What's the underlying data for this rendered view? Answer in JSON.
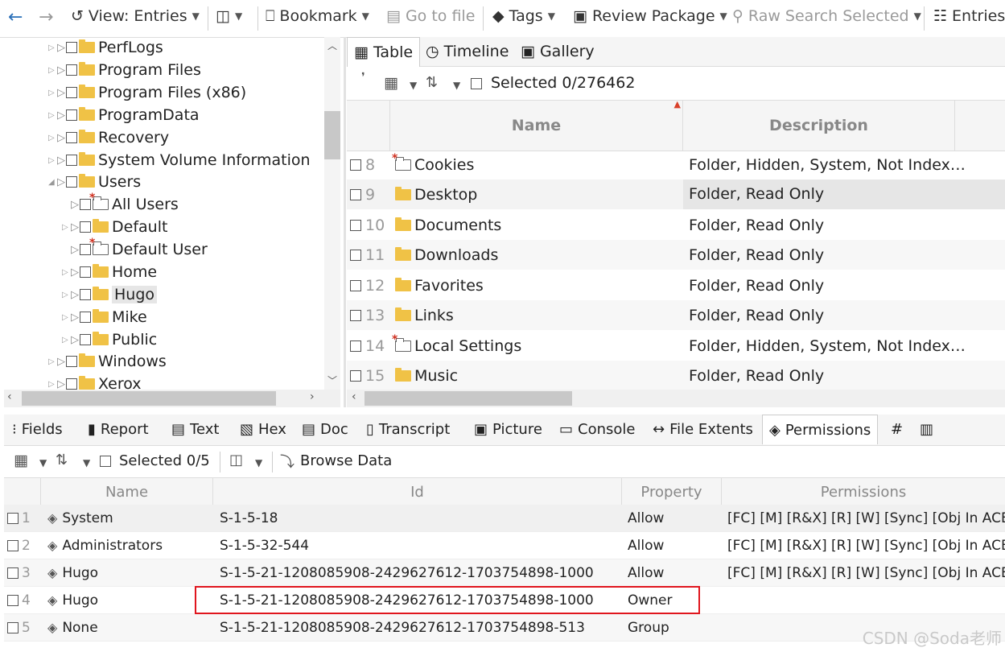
{
  "toolbar": {
    "back": "←",
    "forward": "→",
    "view_label": "View: Entries",
    "bookmark_label": "Bookmark",
    "goto_file_label": "Go to file",
    "tags_label": "Tags",
    "review_package_label": "Review Package",
    "raw_search_label": "Raw Search Selected",
    "entries_label": "Entries"
  },
  "tree": {
    "items": [
      {
        "label": "PerfLogs"
      },
      {
        "label": "Program Files"
      },
      {
        "label": "Program Files (x86)"
      },
      {
        "label": "ProgramData"
      },
      {
        "label": "Recovery"
      },
      {
        "label": "System Volume Information"
      },
      {
        "label": "Users"
      },
      {
        "label": "All Users"
      },
      {
        "label": "Default"
      },
      {
        "label": "Default User"
      },
      {
        "label": "Home"
      },
      {
        "label": "Hugo"
      },
      {
        "label": "Mike"
      },
      {
        "label": "Public"
      },
      {
        "label": "Windows"
      },
      {
        "label": "Xerox"
      }
    ]
  },
  "main_tabs": [
    {
      "label": "Table"
    },
    {
      "label": "Timeline"
    },
    {
      "label": "Gallery"
    }
  ],
  "main_selected": "Selected 0/276462",
  "main_columns": {
    "name": "Name",
    "description": "Description"
  },
  "main_rows": [
    {
      "idx": "8",
      "name": "Cookies",
      "desc": "Folder, Hidden, System, Not Index…"
    },
    {
      "idx": "9",
      "name": "Desktop",
      "desc": "Folder, Read Only"
    },
    {
      "idx": "10",
      "name": "Documents",
      "desc": "Folder, Read Only"
    },
    {
      "idx": "11",
      "name": "Downloads",
      "desc": "Folder, Read Only"
    },
    {
      "idx": "12",
      "name": "Favorites",
      "desc": "Folder, Read Only"
    },
    {
      "idx": "13",
      "name": "Links",
      "desc": "Folder, Read Only"
    },
    {
      "idx": "14",
      "name": "Local Settings",
      "desc": "Folder, Hidden, System, Not Index…"
    },
    {
      "idx": "15",
      "name": "Music",
      "desc": "Folder, Read Only"
    }
  ],
  "bottom_tabs": [
    {
      "label": "Fields"
    },
    {
      "label": "Report"
    },
    {
      "label": "Text"
    },
    {
      "label": "Hex"
    },
    {
      "label": "Doc"
    },
    {
      "label": "Transcript"
    },
    {
      "label": "Picture"
    },
    {
      "label": "Console"
    },
    {
      "label": "File Extents"
    },
    {
      "label": "Permissions"
    }
  ],
  "bottom_selected": "Selected 0/5",
  "browse_data_label": "Browse Data",
  "perm_columns": {
    "name": "Name",
    "id": "Id",
    "property": "Property",
    "permissions": "Permissions"
  },
  "perm_rows": [
    {
      "idx": "1",
      "name": "System",
      "id": "S-1-5-18",
      "property": "Allow",
      "perms": "[FC] [M] [R&X] [R] [W] [Sync] [Obj In ACE] [..."
    },
    {
      "idx": "2",
      "name": "Administrators",
      "id": "S-1-5-32-544",
      "property": "Allow",
      "perms": "[FC] [M] [R&X] [R] [W] [Sync] [Obj In ACE] [..."
    },
    {
      "idx": "3",
      "name": "Hugo",
      "id": "S-1-5-21-1208085908-2429627612-1703754898-1000",
      "property": "Allow",
      "perms": "[FC] [M] [R&X] [R] [W] [Sync] [Obj In ACE] [..."
    },
    {
      "idx": "4",
      "name": "Hugo",
      "id": "S-1-5-21-1208085908-2429627612-1703754898-1000",
      "property": "Owner",
      "perms": ""
    },
    {
      "idx": "5",
      "name": "None",
      "id": "S-1-5-21-1208085908-2429627612-1703754898-513",
      "property": "Group",
      "perms": ""
    }
  ],
  "watermark": "CSDN @Soda老师",
  "colors": {
    "highlight_box": "#e0161e",
    "folder": "#f0c246"
  }
}
